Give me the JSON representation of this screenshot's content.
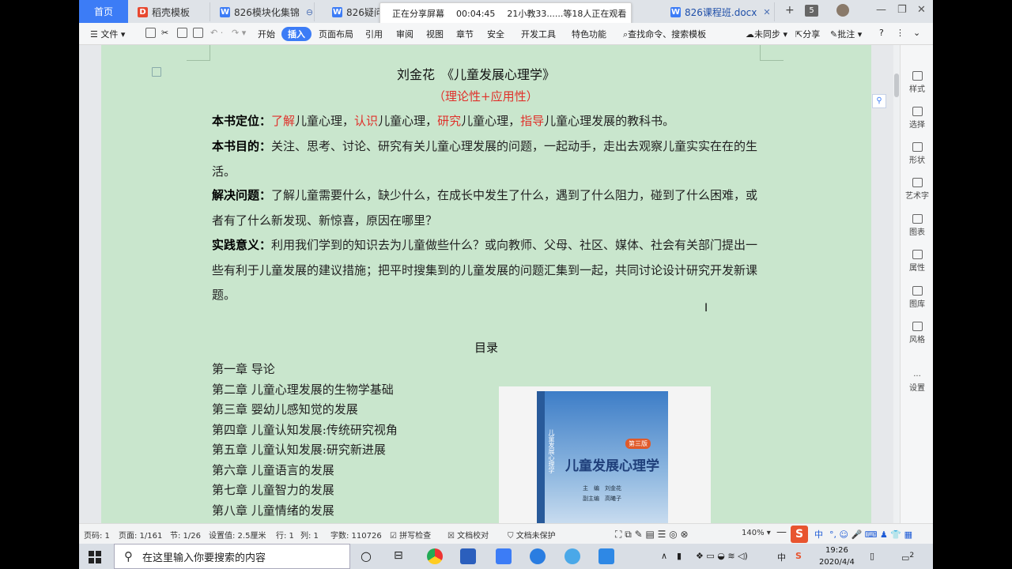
{
  "tabs": {
    "home": "首页",
    "t1": "稻壳模板",
    "t2": "826模块化集锦",
    "t3": "826疑问",
    "t4": "826课程班.docx",
    "count": "5"
  },
  "share_popup": {
    "status": "正在分享屏幕",
    "time": "00:04:45",
    "viewers": "21小教33......等18人正在观看"
  },
  "ribbon": {
    "file": "文件",
    "start": "开始",
    "insert": "插入",
    "layout": "页面布局",
    "reference": "引用",
    "review": "审阅",
    "view": "视图",
    "chapter": "章节",
    "security": "安全",
    "devtools": "开发工具",
    "features": "特色功能",
    "search": "查找命令、搜索模板",
    "sync": "未同步",
    "share": "分享",
    "comment": "批注"
  },
  "doc": {
    "title": "刘金花　《儿童发展心理学》",
    "subtitle": "（理论性+应用性）",
    "p1_label": "本书定位：",
    "p1_a": "了解",
    "p1_b": "儿童心理，",
    "p1_c": "认识",
    "p1_d": "儿童心理，",
    "p1_e": "研究",
    "p1_f": "儿童心理，",
    "p1_g": "指导",
    "p1_h": "儿童心理发展的教科书。",
    "p2_label": "本书目的：",
    "p2_text": "关注、思考、讨论、研究有关儿童心理发展的问题，一起动手，走出去观察儿童实实在在的生活。",
    "p3_label": "解决问题：",
    "p3_text": "了解儿童需要什么，缺少什么，在成长中发生了什么，遇到了什么阻力，碰到了什么困难，或者有了什么新发现、新惊喜，原因在哪里？",
    "p4_label": "实践意义：",
    "p4_text": "利用我们学到的知识去为儿童做些什么？或向教师、父母、社区、媒体、社会有关部门提出一些有利于儿童发展的建议措施；把平时搜集到的儿童发展的问题汇集到一起，共同讨论设计研究开发新课题。",
    "toc_title": "目录",
    "toc": [
      "第一章  导论",
      "第二章  儿童心理发展的生物学基础",
      "第三章  婴幼儿感知觉的发展",
      "第四章  儿童认知发展:传统研究视角",
      "第五章  儿童认知发展:研究新进展",
      "第六章  儿童语言的发展",
      "第七章  儿童智力的发展",
      "第八章  儿童情绪的发展"
    ],
    "cover": {
      "title": "儿童发展心理学",
      "edition": "第三版",
      "editor": "主　编　刘金花",
      "deputy": "副主编　高曦子",
      "spine": "儿童发展心理学"
    }
  },
  "sidepanel": [
    "样式",
    "选择",
    "形状",
    "艺术字",
    "图表",
    "属性",
    "图库",
    "风格",
    "设置"
  ],
  "status": {
    "page_no": "页码: 1",
    "page": "页面: 1/161",
    "section": "节: 1/26",
    "setting": "设置值: 2.5厘米",
    "row": "行: 1",
    "col": "列: 1",
    "words": "字数: 110726",
    "spell": "拼写检查",
    "proof": "文档校对",
    "protect": "文档未保护",
    "zoom": "140%",
    "ime": "中"
  },
  "taskbar": {
    "search_placeholder": "在这里输入你要搜索的内容",
    "time": "19:26",
    "date": "2020/4/4",
    "ime": "中",
    "notif": "2"
  }
}
